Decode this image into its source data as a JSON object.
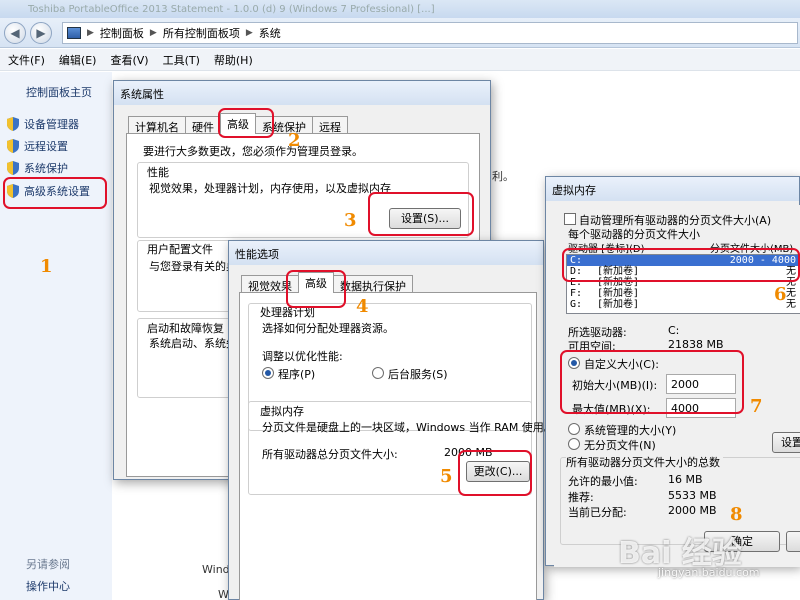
{
  "explorer": {
    "title": "Toshiba PortableOffice 2013 Statement - 1.0.0 (d) 9 (Windows 7 Professional) [...]",
    "breadcrumb": [
      "控制面板",
      "所有控制面板项",
      "系统"
    ],
    "menu": [
      "文件(F)",
      "编辑(E)",
      "查看(V)",
      "工具(T)",
      "帮助(H)"
    ],
    "sidebar": {
      "home": "控制面板主页",
      "items": [
        {
          "label": "设备管理器",
          "icon": "shield-icon"
        },
        {
          "label": "远程设置",
          "icon": "shield-icon"
        },
        {
          "label": "系统保护",
          "icon": "shield-icon"
        },
        {
          "label": "高级系统设置",
          "icon": "shield-icon"
        }
      ],
      "see_also": "另请参阅",
      "action_center": "操作中心"
    },
    "bg_fragments": {
      "right_edge": "利。",
      "win_prefix": "Wind",
      "w_prefix": "W"
    }
  },
  "system_properties": {
    "title": "系统属性",
    "tabs": [
      "计算机名",
      "硬件",
      "高级",
      "系统保护",
      "远程"
    ],
    "active_tab": "高级",
    "admin_note": "要进行大多数更改，您必须作为管理员登录。",
    "performance": {
      "heading": "性能",
      "description": "视觉效果，处理器计划，内存使用，以及虚拟内存",
      "settings_button": "设置(S)..."
    },
    "user_profiles": {
      "heading": "用户配置文件",
      "description": "与您登录有关的桌"
    },
    "startup_recovery": {
      "heading": "启动和故障恢复",
      "description": "系统启动、系统失"
    }
  },
  "performance_options": {
    "title": "性能选项",
    "tabs": [
      "视觉效果",
      "高级",
      "数据执行保护"
    ],
    "active_tab": "高级",
    "processor_heading": "处理器计划",
    "processor_desc": "选择如何分配处理器资源。",
    "adjust_label": "调整以优化性能:",
    "option_programs": "程序(P)",
    "option_services": "后台服务(S)",
    "vm_heading": "虚拟内存",
    "vm_desc": "分页文件是硬盘上的一块区域，Windows 当作 RAM 使用。",
    "vm_total_label": "所有驱动器总分页文件大小:",
    "vm_total_value": "2000 MB",
    "change_button": "更改(C)..."
  },
  "virtual_memory": {
    "title": "虚拟内存",
    "auto_manage": "自动管理所有驱动器的分页文件大小(A)",
    "per_drive_heading": "每个驱动器的分页文件大小",
    "col_drive": "驱动器 [卷标](D)",
    "col_size": "分页文件大小(MB)",
    "drives": [
      {
        "letter": "C:",
        "label": "",
        "size": "2000 - 4000",
        "selected": true
      },
      {
        "letter": "D:",
        "label": "[新加卷]",
        "size": "无",
        "selected": false
      },
      {
        "letter": "E:",
        "label": "[新加卷]",
        "size": "无",
        "selected": false
      },
      {
        "letter": "F:",
        "label": "[新加卷]",
        "size": "无",
        "selected": false
      },
      {
        "letter": "G:",
        "label": "[新加卷]",
        "size": "无",
        "selected": false
      }
    ],
    "selected_drive_label": "所选驱动器:",
    "selected_drive_value": "C:",
    "free_space_label": "可用空间:",
    "free_space_value": "21838 MB",
    "custom_size": "自定义大小(C):",
    "initial_label": "初始大小(MB)(I):",
    "initial_value": "2000",
    "max_label": "最大值(MB)(X):",
    "max_value": "4000",
    "system_managed": "系统管理的大小(Y)",
    "no_paging": "无分页文件(N)",
    "set_button": "设置",
    "total_heading": "所有驱动器分页文件大小的总数",
    "min_allowed_label": "允许的最小值:",
    "min_allowed_value": "16 MB",
    "recommended_label": "推荐:",
    "recommended_value": "5533 MB",
    "current_label": "当前已分配:",
    "current_value": "2000 MB",
    "ok_button": "确定"
  },
  "steps": [
    "1",
    "2",
    "3",
    "4",
    "5",
    "6",
    "7",
    "8"
  ],
  "watermark": {
    "logo": "Bai 经验",
    "url": "jingyan.baidu.com"
  },
  "colors": {
    "highlight": "#e0102a",
    "step_number": "#f08a00",
    "selection": "#3a6fd0"
  }
}
